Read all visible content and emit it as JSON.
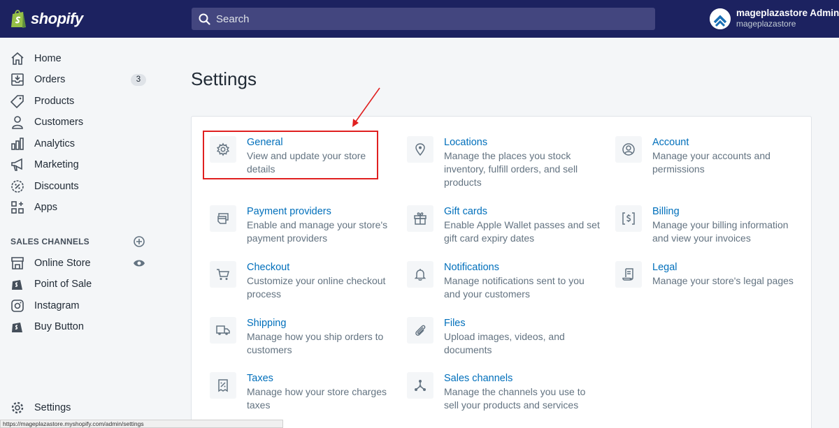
{
  "brand": {
    "name": "shopify"
  },
  "search": {
    "placeholder": "Search"
  },
  "user": {
    "name": "mageplazastore Admin",
    "store": "mageplazastore"
  },
  "nav": {
    "home": "Home",
    "orders": "Orders",
    "orders_badge": "3",
    "products": "Products",
    "customers": "Customers",
    "analytics": "Analytics",
    "marketing": "Marketing",
    "discounts": "Discounts",
    "apps": "Apps",
    "settings": "Settings"
  },
  "sales_channels": {
    "title": "SALES CHANNELS",
    "online_store": "Online Store",
    "point_of_sale": "Point of Sale",
    "instagram": "Instagram",
    "buy_button": "Buy Button"
  },
  "page": {
    "title": "Settings"
  },
  "settings": {
    "general": {
      "title": "General",
      "desc1": "View and update your store",
      "desc2": "details"
    },
    "locations": {
      "title": "Locations",
      "desc1": "Manage the places you stock",
      "desc2": "inventory, fulfill orders, and sell",
      "desc3": "products"
    },
    "account": {
      "title": "Account",
      "desc1": "Manage your accounts and",
      "desc2": "permissions"
    },
    "payment_providers": {
      "title": "Payment providers",
      "desc1": "Enable and manage your store's",
      "desc2": "payment providers"
    },
    "gift_cards": {
      "title": "Gift cards",
      "desc1": "Enable Apple Wallet passes and set",
      "desc2": "gift card expiry dates"
    },
    "billing": {
      "title": "Billing",
      "desc1": "Manage your billing information",
      "desc2": "and view your invoices"
    },
    "checkout": {
      "title": "Checkout",
      "desc1": "Customize your online checkout",
      "desc2": "process"
    },
    "notifications": {
      "title": "Notifications",
      "desc1": "Manage notifications sent to you",
      "desc2": "and your customers"
    },
    "legal": {
      "title": "Legal",
      "desc1": "Manage your store's legal pages"
    },
    "shipping": {
      "title": "Shipping",
      "desc1": "Manage how you ship orders to",
      "desc2": "customers"
    },
    "files": {
      "title": "Files",
      "desc1": "Upload images, videos, and",
      "desc2": "documents"
    },
    "taxes": {
      "title": "Taxes",
      "desc1": "Manage how your store charges",
      "desc2": "taxes"
    },
    "sales_channels": {
      "title": "Sales channels",
      "desc1": "Manage the channels you use to",
      "desc2": "sell your products and services"
    }
  },
  "status_url": "https://mageplazastore.myshopify.com/admin/settings",
  "colors": {
    "topbar": "#1c2260",
    "link": "#006fbb",
    "highlight": "#e02020"
  }
}
